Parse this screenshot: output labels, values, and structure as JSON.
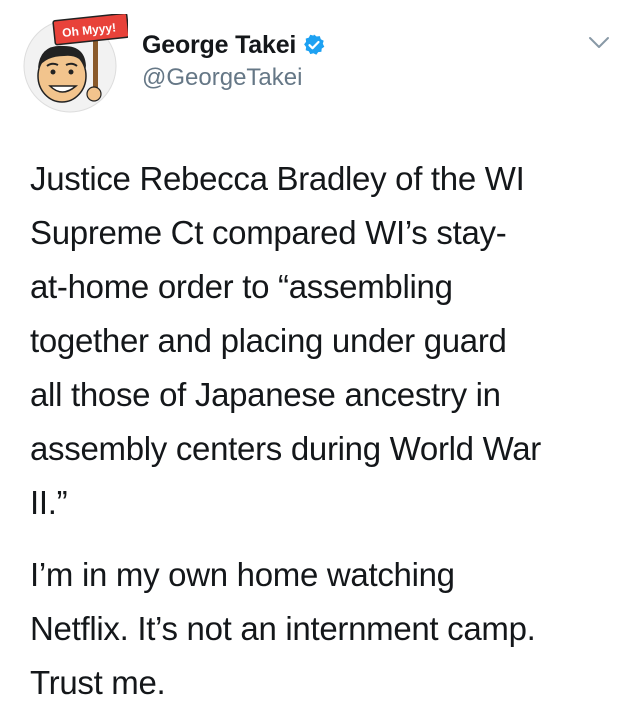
{
  "tweet": {
    "author": {
      "display_name": "George Takei",
      "handle": "@GeorgeTakei",
      "avatar_sign_text": "Oh Myyy!",
      "verified": true
    },
    "body": {
      "paragraph_1": [
        "Justice Rebecca Bradley of the WI",
        "Supreme Ct compared WI’s stay-",
        "at-home order to “assembling",
        "together and placing under guard",
        "all those of Japanese ancestry in",
        "assembly centers during World War",
        "II.”"
      ],
      "paragraph_2": [
        "I’m in my own home watching",
        "Netflix. It’s not an internment camp.",
        "Trust me."
      ]
    }
  },
  "colors": {
    "text": "#14171a",
    "secondary_text": "#657786",
    "verified_blue": "#1da1f2",
    "sign_red": "#e8423a"
  },
  "icons": {
    "verified": "verified-badge-icon",
    "menu": "chevron-down-icon"
  }
}
